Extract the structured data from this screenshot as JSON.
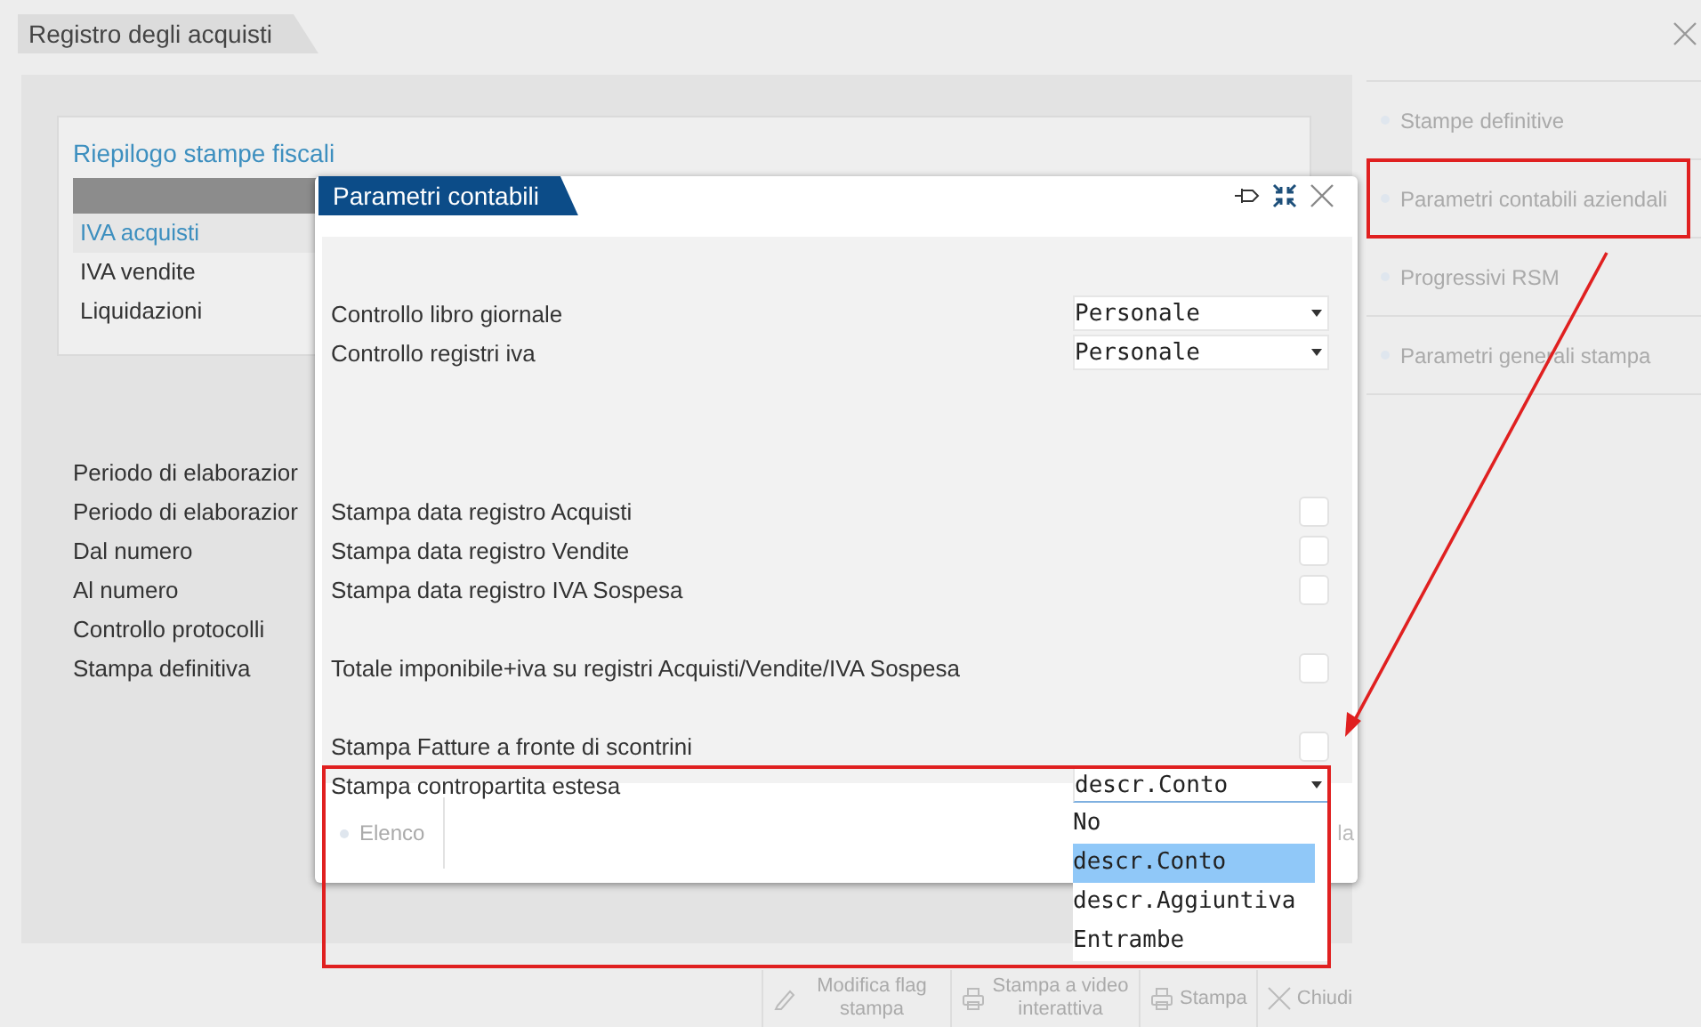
{
  "window": {
    "title": "Registro degli acquisti"
  },
  "summary": {
    "title": "Riepilogo stampe fiscali",
    "rows": [
      {
        "label": "IVA acquisti",
        "selected": true
      },
      {
        "label": "IVA vendite",
        "selected": false
      },
      {
        "label": "Liquidazioni",
        "selected": false
      }
    ]
  },
  "field_labels": [
    "Periodo di elaborazior",
    "Periodo di elaborazior",
    "Dal numero",
    "Al numero",
    "Controllo protocolli",
    "Stampa definitiva"
  ],
  "sidebar": {
    "items": [
      {
        "label": "Stampe definitive",
        "annotated": false
      },
      {
        "label": "Parametri contabili aziendali",
        "annotated": true
      },
      {
        "label": "Progressivi RSM",
        "annotated": false
      },
      {
        "label": "Parametri generali stampa",
        "annotated": false
      }
    ]
  },
  "toolbar": [
    {
      "label": "Modifica flag stampa"
    },
    {
      "label": "Stampa a video interattiva"
    },
    {
      "label": "Stampa"
    },
    {
      "label": "Chiudi"
    }
  ],
  "dialog": {
    "title": "Parametri contabili",
    "groups": [
      [
        {
          "kind": "select",
          "label": "Controllo libro giornale",
          "value": "Personale"
        },
        {
          "kind": "select",
          "label": "Controllo registri iva",
          "value": "Personale"
        }
      ],
      [
        {
          "kind": "checkbox",
          "label": "Stampa data registro Acquisti",
          "checked": false
        },
        {
          "kind": "checkbox",
          "label": "Stampa data registro Vendite",
          "checked": false
        },
        {
          "kind": "checkbox",
          "label": "Stampa data registro IVA Sospesa",
          "checked": false
        }
      ],
      [
        {
          "kind": "checkbox",
          "label": "Totale imponibile+iva su registri Acquisti/Vendite/IVA Sospesa",
          "checked": false
        }
      ],
      [
        {
          "kind": "checkbox",
          "label": "Stampa Fatture a fronte di scontrini",
          "checked": false
        },
        {
          "kind": "select",
          "label": "Stampa contropartita estesa",
          "value": "descr.Conto",
          "annotated": true,
          "options": [
            {
              "label": "No",
              "selected": false
            },
            {
              "label": "descr.Conto",
              "selected": true
            },
            {
              "label": "descr.Aggiuntiva",
              "selected": false
            },
            {
              "label": "Entrambe",
              "selected": false
            }
          ]
        }
      ]
    ],
    "footer": {
      "button": "Elenco",
      "partial_text": "la"
    }
  }
}
